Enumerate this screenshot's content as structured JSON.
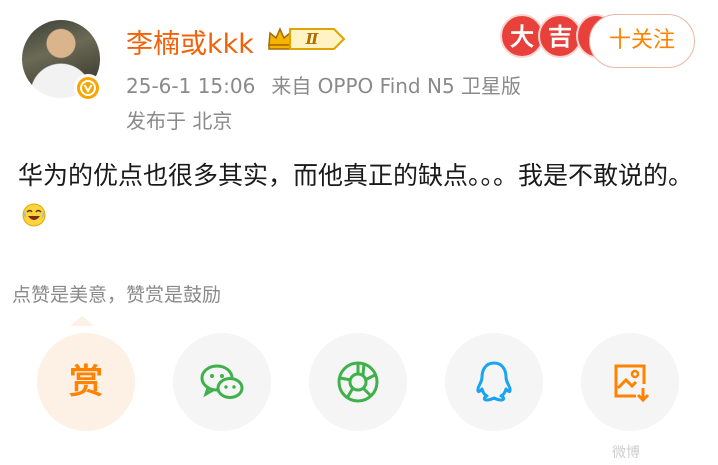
{
  "user": {
    "name": "李楠或kkk",
    "vip_level": "Ⅱ",
    "icons": {
      "avatar_badge": "verified-badge-icon",
      "vip_crown": "vip-crown-icon"
    }
  },
  "post_meta": {
    "time": "25-6-1 15:06",
    "source": "来自 OPPO Find N5 卫星版",
    "location": "发布于 北京"
  },
  "decoration": [
    "大",
    "吉"
  ],
  "follow_button": {
    "label": "十关注"
  },
  "post": {
    "text": "华为的优点也很多其实，而他真正的缺点。。。我是不敢说的。",
    "emoji": "laughing-tears-icon"
  },
  "reward": {
    "tip": "点赞是美意，赞赏是鼓励",
    "button_label": "赏"
  },
  "share_buttons": [
    {
      "icon": "wechat-icon",
      "color": "#3fb14a"
    },
    {
      "icon": "moments-icon",
      "color": "#3fb14a"
    },
    {
      "icon": "qq-icon",
      "color": "#1aa3f0"
    },
    {
      "icon": "save-image-icon",
      "color": "#ff8200"
    }
  ],
  "watermark": "微博",
  "colors": {
    "username": "#f0620a",
    "accent": "#ff8200",
    "meta": "#8a8a8a"
  }
}
